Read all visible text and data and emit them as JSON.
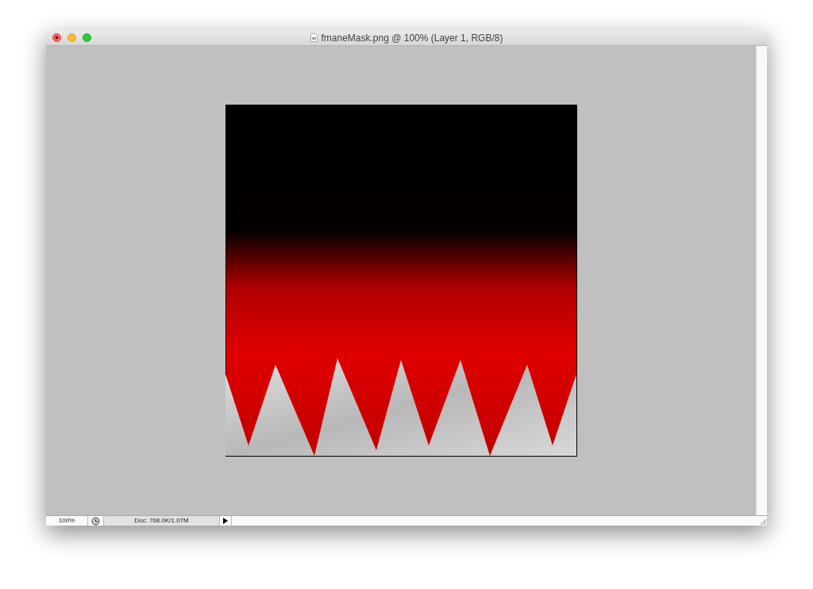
{
  "window": {
    "title": "fmaneMask.png @ 100% (Layer 1, RGB/8)"
  },
  "status_bar": {
    "zoom": "100%",
    "doc_info": "Doc: 768.0K/1.07M"
  }
}
